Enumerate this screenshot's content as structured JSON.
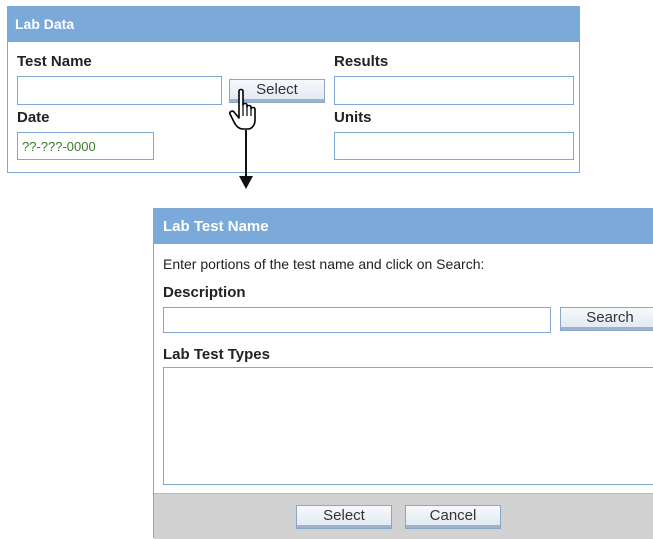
{
  "lab_data": {
    "title": "Lab Data",
    "test_name_label": "Test Name",
    "test_name_value": "",
    "select_button": "Select",
    "results_label": "Results",
    "results_value": "",
    "date_label": "Date",
    "date_value": "??-???-0000",
    "units_label": "Units",
    "units_value": ""
  },
  "lab_test_name": {
    "title": "Lab Test Name",
    "instruction": "Enter portions of the test name and click on Search:",
    "description_label": "Description",
    "description_value": "",
    "search_button": "Search",
    "types_label": "Lab Test Types",
    "select_button": "Select",
    "cancel_button": "Cancel"
  },
  "icons": {
    "cursor": "hand-pointer-icon",
    "connector": "down-arrow-icon"
  },
  "colors": {
    "header_bg": "#7aa9da",
    "border": "#7fa9d4",
    "footer_bg": "#d2d2d2"
  }
}
